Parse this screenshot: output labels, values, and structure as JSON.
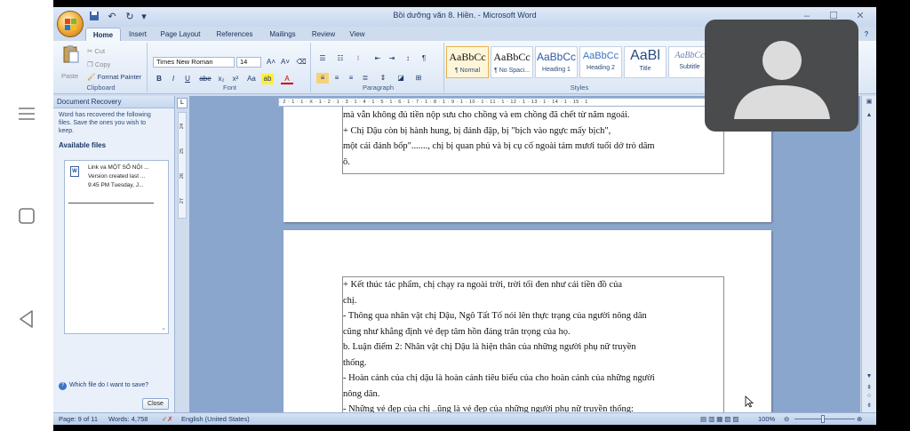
{
  "window": {
    "title": "Bồi dưỡng văn 8. Hiền. - Microsoft Word",
    "minimize": "–",
    "maximize": "☐",
    "close": "✕"
  },
  "quick_access": [
    "save-icon",
    "undo-icon",
    "redo-icon"
  ],
  "tabs": [
    "Home",
    "Insert",
    "Page Layout",
    "References",
    "Mailings",
    "Review",
    "View"
  ],
  "ribbon": {
    "clipboard": {
      "label": "Clipboard",
      "paste": "Paste",
      "cut": "Cut",
      "copy": "Copy",
      "format_painter": "Format Painter"
    },
    "font": {
      "label": "Font",
      "font_name": "Times New Roman",
      "font_size": "14",
      "buttons": [
        "B",
        "I",
        "U",
        "abe",
        "x₂",
        "x²",
        "Aa",
        "A"
      ]
    },
    "paragraph": {
      "label": "Paragraph"
    },
    "styles": {
      "label": "Styles",
      "items": [
        {
          "sample": "AaBbCc",
          "name": "¶ Normal"
        },
        {
          "sample": "AaBbCc",
          "name": "¶ No Spaci..."
        },
        {
          "sample": "AaBbCc",
          "name": "Heading 1"
        },
        {
          "sample": "AaBbCc",
          "name": "Heading 2"
        },
        {
          "sample": "AaBl",
          "name": "Title"
        },
        {
          "sample": "AaBbCc",
          "name": "Subtitle"
        }
      ]
    }
  },
  "recovery": {
    "header": "Document Recovery",
    "message": [
      "Word has recovered the following",
      "files.  Save the ones you wish to",
      "keep."
    ],
    "available_label": "Available files",
    "file": {
      "name": "Link va MỘT SỐ NỘI ...",
      "version": "Version created last ...",
      "time": "9:45 PM Tuesday, J..."
    },
    "help_link": "Which file do I want to save?",
    "close_label": "Close"
  },
  "ruler_text": "· 2 · 1 · 1 · X · 1 · 2 · 1 · 3 · 1 · 4 · 1 · 5 · 1 · 6 · 1 · 7 · 1 · 8 · 1 · 9 · 1 · 10 · 1 · 11 · 1 · 12 · 1 · 13 · 1 · 14 · 1 · 15 · 1",
  "vruler_nums": [
    "24",
    "25",
    "26",
    "27"
  ],
  "document": {
    "page1_lines": [
      "mà vẫn không đủ tiền nộp sưu cho chồng và em chồng đã chết từ năm ngoái.",
      "          + Chị Dậu còn bị hành hung, bị đánh đập, bị \"bịch vào ngực mấy bịch\",",
      "một cái đánh bốp\"......., chị bị quan phủ và bị cụ cố ngoài tám mươi tuổi dở trò dâm",
      "ô."
    ],
    "page2_lines": [
      "          + Kết thúc tác phẩm, chị chạy ra ngoài trời, trời tối đen như cái tiền đồ của",
      "chị.",
      "- Thông qua nhân vật chị Dậu, Ngô Tất Tố nói lên thực trạng của người nông dân",
      "cũng như khẳng định vẻ đẹp tâm hồn đáng trân trọng của họ.",
      "b. Luận điểm 2: Nhân vật chị Dậu là hiện thân của những người phụ nữ truyền",
      "thống.",
      "- Hoàn cảnh của chị dậu là hoàn cảnh tiêu biểu của cho hoàn cảnh của những người",
      "nông dân.",
      "- Những vẻ đẹp của chị ..ũng là vẻ đẹp của những người phụ nữ truyền thống:"
    ]
  },
  "status": {
    "page": "Page: 9 of 11",
    "words": "Words: 4,758",
    "language": "English (United States)",
    "zoom": "100%"
  }
}
